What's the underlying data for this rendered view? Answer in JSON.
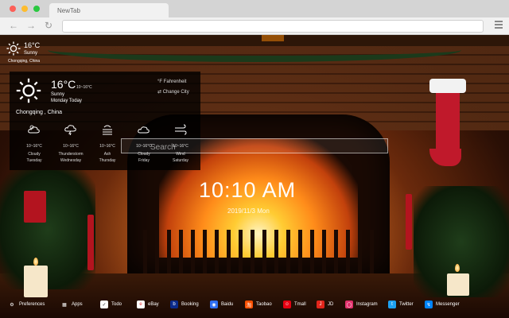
{
  "browser": {
    "tab_title": "NewTab"
  },
  "mini_weather": {
    "temp": "16°C",
    "condition": "Sunny",
    "location": "Chongqing, China"
  },
  "weather_panel": {
    "temp": "16°C",
    "range": "10~16°C",
    "condition": "Sunny",
    "day": "Monday Today",
    "location": "Chongqing , China",
    "unit_toggle": "°F Fahrenheit",
    "change_city": "⇄ Change City",
    "forecast": [
      {
        "icon": "cloudy-icon",
        "range": "10~16°C",
        "condition": "Cloudy",
        "day": "Tuesday"
      },
      {
        "icon": "thunderstorm-icon",
        "range": "10~16°C",
        "condition": "Thunderstorm",
        "day": "Wednesday"
      },
      {
        "icon": "ash-icon",
        "range": "10~16°C",
        "condition": "Ash",
        "day": "Thursday"
      },
      {
        "icon": "cloudy-icon",
        "range": "10~16°C",
        "condition": "Cloudy",
        "day": "Friday"
      },
      {
        "icon": "wind-icon",
        "range": "10~16°C",
        "condition": "Wind",
        "day": "Saturday"
      }
    ]
  },
  "search": {
    "placeholder": "Search"
  },
  "clock": {
    "time": "10:10 AM",
    "date": "2019/11/3 Mon"
  },
  "bottom_bar": {
    "items": [
      {
        "label": "Preferences",
        "icon": "gear-icon",
        "color": "#000000"
      },
      {
        "label": "Apps",
        "icon": "grid-icon",
        "color": "#000000"
      },
      {
        "label": "Todo",
        "icon": "check-icon",
        "color": "#ffffff"
      },
      {
        "label": "eBay",
        "icon": "ebay-icon",
        "color": "#ffffff"
      },
      {
        "label": "Booking",
        "icon": "booking-icon",
        "color": "#0b2a8a"
      },
      {
        "label": "Baidu",
        "icon": "baidu-icon",
        "color": "#2f6ff5"
      },
      {
        "label": "Taobao",
        "icon": "taobao-icon",
        "color": "#ff5000"
      },
      {
        "label": "Tmall",
        "icon": "tmall-icon",
        "color": "#e60012"
      },
      {
        "label": "JD",
        "icon": "jd-icon",
        "color": "#e1251b"
      },
      {
        "label": "Instagram",
        "icon": "instagram-icon",
        "color": "#e1306c"
      },
      {
        "label": "Twitter",
        "icon": "twitter-icon",
        "color": "#1da1f2"
      },
      {
        "label": "Messenger",
        "icon": "messenger-icon",
        "color": "#0084ff"
      }
    ]
  }
}
